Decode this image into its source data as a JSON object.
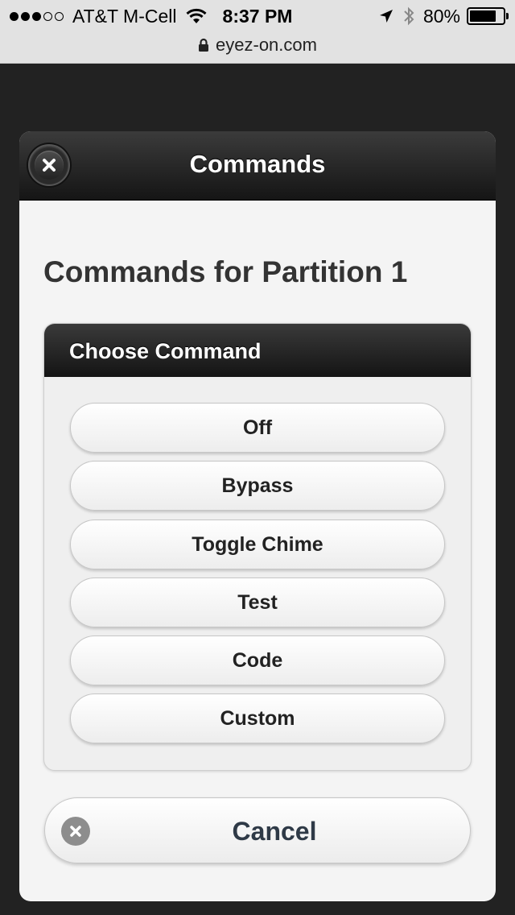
{
  "status_bar": {
    "carrier": "AT&T M-Cell",
    "signal_bars_filled": 3,
    "signal_bars_total": 5,
    "time": "8:37 PM",
    "battery_percent": "80%",
    "battery_level": 0.8,
    "icons": [
      "wifi-icon",
      "location-arrow-icon",
      "bluetooth-icon",
      "battery-icon"
    ]
  },
  "browser": {
    "url": "eyez-on.com",
    "secure_icon": "lock-icon"
  },
  "dialog": {
    "title": "Commands",
    "close_icon": "close-icon",
    "heading": "Commands for Partition 1",
    "panel_title": "Choose Command",
    "commands": [
      {
        "label": "Off"
      },
      {
        "label": "Bypass"
      },
      {
        "label": "Toggle Chime"
      },
      {
        "label": "Test"
      },
      {
        "label": "Code"
      },
      {
        "label": "Custom"
      }
    ],
    "cancel_label": "Cancel",
    "cancel_icon": "close-circle-icon"
  },
  "colors": {
    "header_dark": "#151515",
    "page_background": "#222222",
    "dialog_background": "#f4f4f4",
    "cancel_text": "#2f3a47"
  }
}
